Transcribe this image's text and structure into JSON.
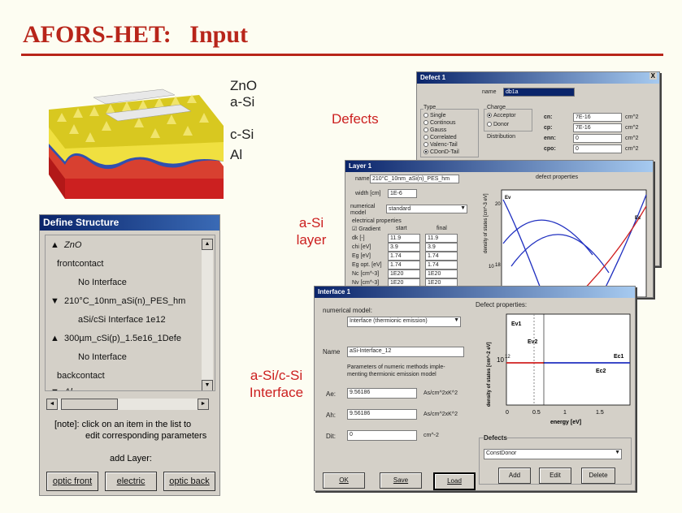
{
  "title": "AFORS-HET:   Input",
  "cell_labels": [
    "ZnO",
    "a-Si",
    "c-Si",
    "Al"
  ],
  "section_labels": {
    "defects": "Defects",
    "asi_layer_1": "a-Si",
    "asi_layer_2": "layer",
    "interface_1": "a-Si/c-Si",
    "interface_2": "Interface"
  },
  "define_structure": {
    "title": "Define Structure",
    "items": [
      {
        "prefix": "▲",
        "text": "ZnO",
        "italic": true
      },
      {
        "prefix": "",
        "text": "frontcontact",
        "italic": false
      },
      {
        "prefix": "",
        "text": "No Interface",
        "italic": false
      },
      {
        "prefix": "▼",
        "text": "210°C_10nm_aSi(n)_PES_hm",
        "italic": false
      },
      {
        "prefix": "",
        "text": "aSi/cSi Interface 1e12",
        "italic": false
      },
      {
        "prefix": "▲",
        "text": "300µm_cSi(p)_1.5e16_1Defe",
        "italic": false
      },
      {
        "prefix": "",
        "text": "No Interface",
        "italic": false
      },
      {
        "prefix": "",
        "text": "backcontact",
        "italic": false
      },
      {
        "prefix": "▼",
        "text": "Al",
        "italic": true
      }
    ],
    "note_1": "[note]: click on an item in the list to",
    "note_2": "edit corresponding parameters",
    "add_layer": "add Layer:",
    "buttons": [
      "optic front",
      "electric",
      "optic back"
    ]
  },
  "defect_window": {
    "title": "Defect 1",
    "name_label": "name",
    "name_value": "db1a",
    "type_label": "Type",
    "types": [
      "Single",
      "Continous",
      "Gauss",
      "Correlated",
      "Valenc-Tail",
      "CDonD-Tail"
    ],
    "charge_label": "Charge",
    "charges": [
      "Acceptor",
      "Donor"
    ],
    "distribution_label": "Distribution",
    "params": [
      {
        "label": "cn:",
        "value": "7E-16",
        "unit": "cm^2"
      },
      {
        "label": "cp:",
        "value": "7E-16",
        "unit": "cm^2"
      },
      {
        "label": "enn:",
        "value": "0",
        "unit": "cm^2"
      },
      {
        "label": "cpo:",
        "value": "0",
        "unit": "cm^2"
      }
    ]
  },
  "layer_window": {
    "title": "Layer 1",
    "name_label": "name",
    "name_value": "210°C_10nm_aSi(n)_PES_hm",
    "width_label": "width [cm]",
    "width_value": "1E-6",
    "model_label": "numerical model",
    "model_value": "standard",
    "electrical_label": "electrical properties",
    "gradient_label": "Gradient",
    "start_label": "start",
    "final_label": "final",
    "rows": [
      {
        "label": "dk [-]",
        "start": "11.9",
        "final": "11.9"
      },
      {
        "label": "chi [eV]",
        "start": "3.9",
        "final": "3.9"
      },
      {
        "label": "Eg [eV]",
        "start": "1.74",
        "final": "1.74"
      },
      {
        "label": "Eg opt. [eV]",
        "start": "1.74",
        "final": "1.74"
      },
      {
        "label": "Nc [cm^-3]",
        "start": "1E20",
        "final": "1E20"
      },
      {
        "label": "Nv [cm^-3]",
        "start": "1E20",
        "final": "1E20"
      }
    ],
    "defect_props_label": "defect properties",
    "plot_ylabel": "density of states [cm^-3 eV]",
    "plot_tick_20": "20",
    "plot_tick_18": "18",
    "plot_tick_10": "10",
    "curve_label_left": "Ev",
    "curve_label_right": "Ec"
  },
  "interface_window": {
    "title": "Interface 1",
    "model_label": "numerical model:",
    "model_value": "Interface (thermionic emission)",
    "name_label": "Name",
    "name_value": "aSi-Interface_12",
    "param_text_1": "Parameters of numeric methods imple-",
    "param_text_2": "menting thermionic emission model",
    "params": [
      {
        "label": "Ae:",
        "value": "9.56186",
        "unit": "As/cm^2xK^2"
      },
      {
        "label": "Ah:",
        "value": "9.56186",
        "unit": "As/cm^2xK^2"
      },
      {
        "label": "Dit:",
        "value": "0",
        "unit": "cm^-2"
      }
    ],
    "defect_props_label": "Defect properties:",
    "plot_ylabel": "density of states [cm^-2 eV]",
    "plot_xlabel": "energy [eV]",
    "plot_ytick": "10",
    "plot_ytick_exp": "12",
    "plot_xticks": [
      "0",
      "0.5",
      "1",
      "1.5"
    ],
    "curve_labels": {
      "ev1": "Ev1",
      "ev2": "Ev2",
      "ec1": "Ec1",
      "ec2": "Ec2"
    },
    "defects_label": "Defects",
    "defects_value": "ConstDonor",
    "defect_buttons": [
      "Add",
      "Edit",
      "Delete"
    ],
    "bottom_buttons": [
      "OK",
      "Save",
      "Load"
    ]
  },
  "colors": {
    "title": "#b8251a",
    "accent_red": "#cc2020",
    "curve_blue": "#2030c0",
    "curve_red": "#d02020"
  }
}
